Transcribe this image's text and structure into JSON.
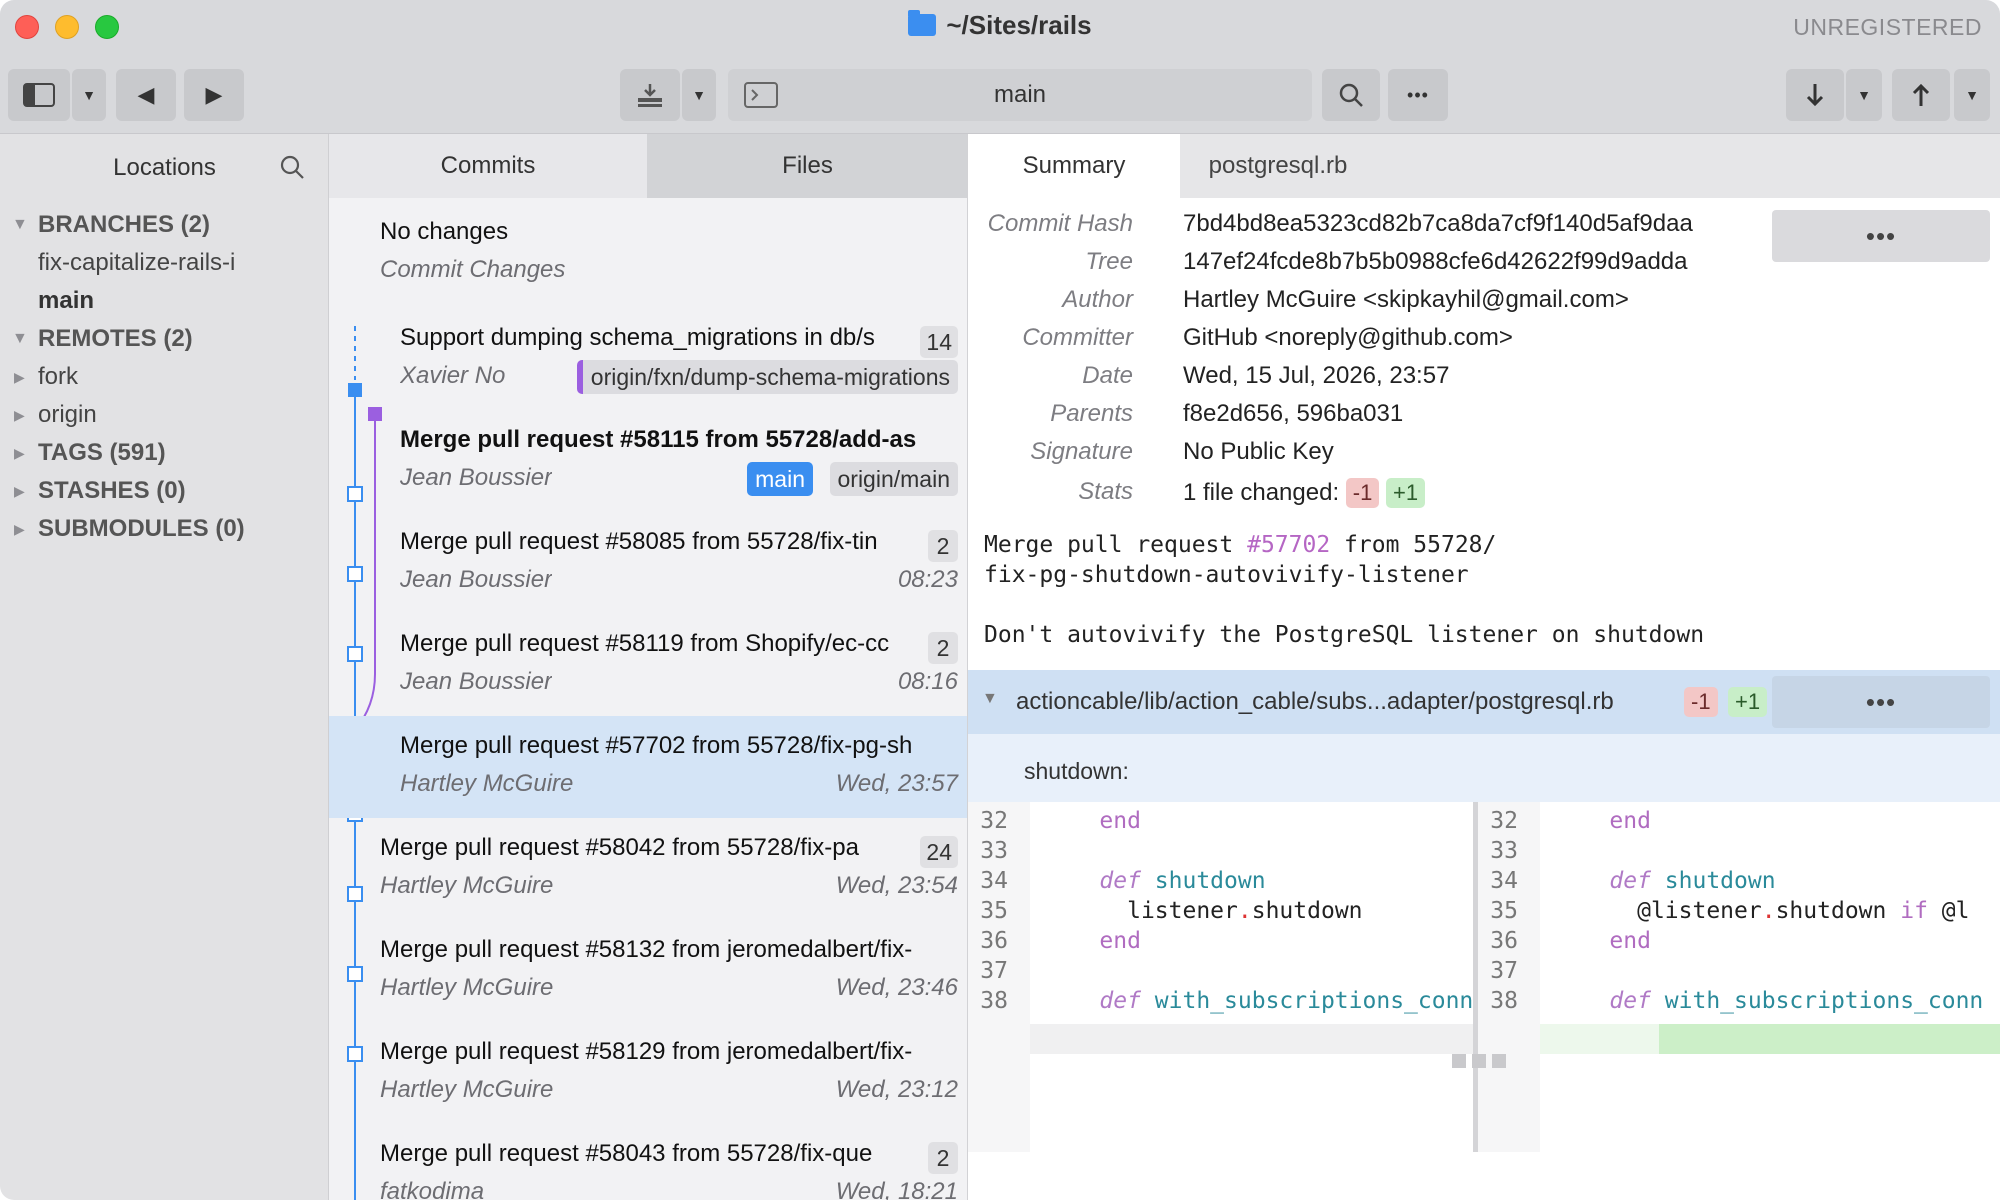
{
  "window": {
    "title": "~/Sites/rails",
    "registration": "UNREGISTERED",
    "traffic_light_colors": {
      "close": "#fe5f57",
      "minimize": "#febc2e",
      "zoom": "#28c840"
    }
  },
  "toolbar": {
    "branch_field": "main",
    "more_label": "•••"
  },
  "sidebar": {
    "header": "Locations",
    "sections": [
      {
        "label": "BRANCHES (2)",
        "expanded": true,
        "children": [
          {
            "label": "fix-capitalize-rails-i",
            "bold": false
          },
          {
            "label": "main",
            "bold": true
          }
        ]
      },
      {
        "label": "REMOTES (2)",
        "expanded": true,
        "children": [
          {
            "label": "fork"
          },
          {
            "label": "origin"
          }
        ]
      },
      {
        "label": "TAGS (591)",
        "expanded": false
      },
      {
        "label": "STASHES (0)",
        "expanded": false
      },
      {
        "label": "SUBMODULES (0)",
        "expanded": false
      }
    ]
  },
  "commits_pane": {
    "tabs": [
      "Commits",
      "Files"
    ],
    "active_tab": "Commits",
    "uncommitted": {
      "title": "No changes",
      "subtitle": "Commit Changes"
    },
    "commits": [
      {
        "title": "Support dumping schema_migrations in db/s",
        "count": "14",
        "author": "Xavier No",
        "badges": [
          {
            "label": "origin/fxn/dump-schema-migrations",
            "style": "grey"
          }
        ]
      },
      {
        "title": "Merge pull request #58115 from 55728/add-as",
        "bold": true,
        "author": "Jean Boussier",
        "badges": [
          {
            "label": "main",
            "style": "blue"
          },
          {
            "label": "origin/main",
            "style": "grey"
          }
        ]
      },
      {
        "title": "Merge pull request #58085 from 55728/fix-tin",
        "count": "2",
        "author": "Jean Boussier",
        "date": "08:23"
      },
      {
        "title": "Merge pull request #58119 from Shopify/ec-cc",
        "count": "2",
        "author": "Jean Boussier",
        "date": "08:16"
      },
      {
        "title": "Merge pull request #57702 from 55728/fix-pg-sh",
        "author": "Hartley McGuire",
        "date": "Wed, 23:57",
        "selected": true
      },
      {
        "title": "Merge pull request #58042 from 55728/fix-pa",
        "count": "24",
        "author": "Hartley McGuire",
        "date": "Wed, 23:54"
      },
      {
        "title": "Merge pull request #58132 from jeromedalbert/fix-",
        "author": "Hartley McGuire",
        "date": "Wed, 23:46"
      },
      {
        "title": "Merge pull request #58129 from jeromedalbert/fix-",
        "author": "Hartley McGuire",
        "date": "Wed, 23:12"
      },
      {
        "title": "Merge pull request #58043 from 55728/fix-que",
        "count": "2",
        "author": "fatkodima",
        "date": "Wed, 18:21"
      }
    ]
  },
  "detail": {
    "tabs": [
      "Summary",
      "postgresql.rb"
    ],
    "active_tab": "Summary",
    "meta": [
      {
        "label": "Commit Hash",
        "value": "7bd4bd8ea5323cd82b7ca8da7cf9f140d5af9daa"
      },
      {
        "label": "Tree",
        "value": "147ef24fcde8b7b5b0988cfe6d42622f99d9adda"
      },
      {
        "label": "Author",
        "value": "Hartley McGuire <skipkayhil@gmail.com>"
      },
      {
        "label": "Committer",
        "value": "GitHub <noreply@github.com>"
      },
      {
        "label": "Date",
        "value": "Wed, 15 Jul, 2026, 23:57"
      },
      {
        "label": "Parents",
        "value": "f8e2d656, 596ba031"
      },
      {
        "label": "Signature",
        "value": "No Public Key"
      },
      {
        "label": "Stats",
        "value": "1 file changed:"
      }
    ],
    "stats": {
      "removed": "-1",
      "added": "+1"
    },
    "message": {
      "line1_pre": "Merge pull request ",
      "line1_hash": "#57702",
      "line1_post": " from 55728/",
      "line2": "fix-pg-shutdown-autovivify-listener",
      "line3": "Don't autovivify the PostgreSQL listener on shutdown"
    },
    "file": {
      "path": "actioncable/lib/action_cable/subs...adapter/postgresql.rb",
      "removed": "-1",
      "added": "+1",
      "context": "shutdown:"
    },
    "diff": {
      "left": [
        {
          "n": "32",
          "parts": [
            [
              "end",
              "kw2"
            ]
          ],
          "indent": "    "
        },
        {
          "n": "33",
          "parts": []
        },
        {
          "n": "34",
          "parts": [
            [
              "def",
              "kw"
            ],
            [
              " ",
              ""
            ],
            [
              "shutdown",
              "fn"
            ]
          ],
          "indent": "    "
        },
        {
          "n": "35",
          "parts": [
            [
              "listener",
              ""
            ],
            [
              ".",
              "dot"
            ],
            [
              "shutdown",
              ""
            ]
          ],
          "indent": "      ",
          "changed": "removed"
        },
        {
          "n": "36",
          "parts": [
            [
              "end",
              "kw2"
            ]
          ],
          "indent": "    "
        },
        {
          "n": "37",
          "parts": []
        },
        {
          "n": "38",
          "parts": [
            [
              "def",
              "kw"
            ],
            [
              " ",
              ""
            ],
            [
              "with_subscriptions_conn",
              "fn"
            ]
          ],
          "indent": "    "
        }
      ],
      "right": [
        {
          "n": "32",
          "parts": [
            [
              "end",
              "kw2"
            ]
          ],
          "indent": "    "
        },
        {
          "n": "33",
          "parts": []
        },
        {
          "n": "34",
          "parts": [
            [
              "def",
              "kw"
            ],
            [
              " ",
              ""
            ],
            [
              "shutdown",
              "fn"
            ]
          ],
          "indent": "    "
        },
        {
          "n": "35",
          "parts": [
            [
              "@listener",
              ""
            ],
            [
              ".",
              "dot"
            ],
            [
              "shutdown",
              ""
            ],
            [
              " ",
              ""
            ],
            [
              "if",
              "kw2"
            ],
            [
              " @l",
              ""
            ]
          ],
          "indent": "      ",
          "changed": "added"
        },
        {
          "n": "36",
          "parts": [
            [
              "end",
              "kw2"
            ]
          ],
          "indent": "    "
        },
        {
          "n": "37",
          "parts": []
        },
        {
          "n": "38",
          "parts": [
            [
              "def",
              "kw"
            ],
            [
              " ",
              ""
            ],
            [
              "with_subscriptions_conn",
              "fn"
            ]
          ],
          "indent": "    "
        }
      ]
    },
    "more_label": "•••"
  }
}
